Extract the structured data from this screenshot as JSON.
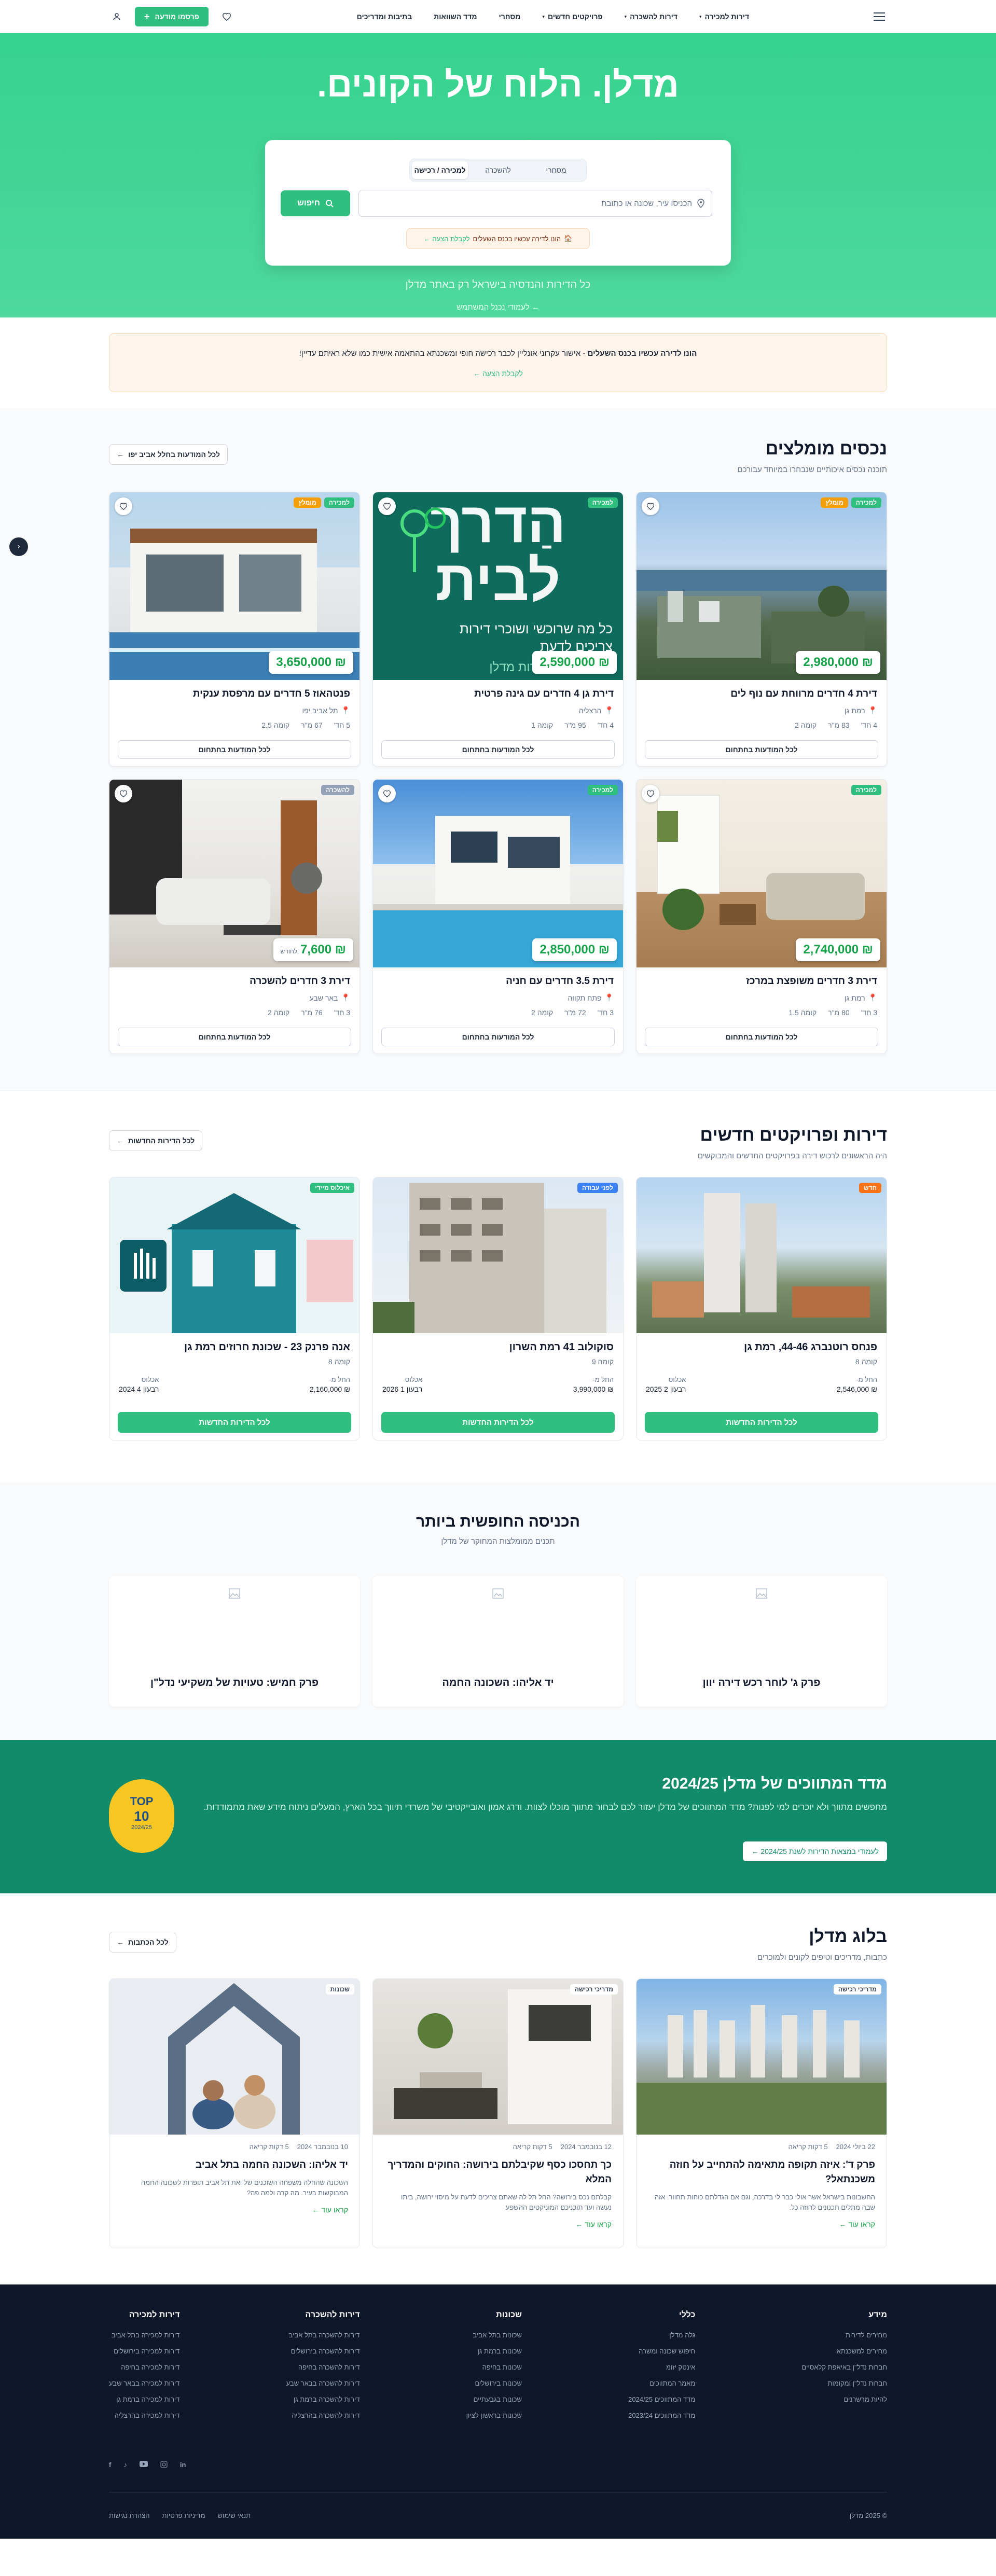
{
  "header": {
    "nav": [
      "דירות למכירה",
      "דירות להשכרה",
      "פרויקטים חדשים",
      "מסחרי",
      "מדד השוואות",
      "בתיבות ומדריכים"
    ],
    "publish_label": "פרסמו מודעה",
    "publish_plus": "+"
  },
  "hero": {
    "title": "מדלן. הלוח של הקונים.",
    "tabs": [
      "למכירה / רכישה",
      "להשכרה",
      "מסחרי"
    ],
    "search_placeholder": "הכניסו עיר, שכונה או כתובת",
    "search_button": "חיפוש",
    "sale_text": "הונו לדירה עכשיו בכנס השעלים",
    "sale_link": "לקבלת הצעה ←",
    "subtitle": "כל הדירות והנדסיה בישראל רק באתר מדלן",
    "more_link": "← לעמודי נכנל המשתמש"
  },
  "promo": {
    "bold": "הונו לדירה עכשיו בכנס השעלים",
    "text": " - אישור עקרוני אונליין לכבר רכישה חופי ומשכנתא בהתאמה אישית כמו שלא ראיתם עדיין!",
    "link": "לקבלת הצעה ←"
  },
  "featured": {
    "title": "נכסים מומלצים",
    "subtitle": "תוכנה נכסים איכותיים שנבחרו במיוחד עבורכם",
    "all_link": "לכל המודעות בחלל אביב יפו",
    "items": [
      {
        "title": "דירת 4 חדרים מרווחת עם נוף לים",
        "location": "רמת גן",
        "rooms": "4 חד'",
        "area": "83 מ\"ר",
        "floor": "קומה 2",
        "price": "₪ 2,980,000",
        "badges": [
          "למכירה",
          "מומלץ"
        ],
        "cta": "לכל המודעות בחתחום"
      },
      {
        "title": "דירת גן 4 חדרים עם גינה פרטית",
        "location": "הרצליה",
        "rooms": "4 חד'",
        "area": "95 מ\"ר",
        "floor": "קומה 1",
        "price": "₪ 2,590,000",
        "badges": [
          "למכירה"
        ],
        "cta": "לכל המודעות בחתחום"
      },
      {
        "title": "פנטהאוז 5 חדרים עם מרפסת ענקית",
        "location": "תל אביב יפו",
        "rooms": "5 חד'",
        "area": "67 מ\"ר",
        "floor": "קומה 2.5",
        "price": "₪ 3,650,000",
        "badges": [
          "למכירה",
          "מומלץ"
        ],
        "cta": "לכל המודעות בחתחום"
      },
      {
        "title": "דירת 3 חדרים משופצת במרכז",
        "location": "רמת גן",
        "rooms": "3 חד'",
        "area": "80 מ\"ר",
        "floor": "קומה 1.5",
        "price": "₪ 2,740,000",
        "badges": [
          "למכירה"
        ],
        "cta": "לכל המודעות בחתחום"
      },
      {
        "title": "דירת 3.5 חדרים עם חניה",
        "location": "פתח תקווה",
        "rooms": "3 חד'",
        "area": "72 מ\"ר",
        "floor": "קומה 2",
        "price": "₪ 2,850,000",
        "badges": [
          "למכירה"
        ],
        "cta": "לכל המודעות בחתחום"
      },
      {
        "title": "דירת 3 חדרים להשכרה",
        "location": "באר שבע",
        "rooms": "3 חד'",
        "area": "76 מ\"ר",
        "floor": "קומה 2",
        "price": "₪ 7,600",
        "price_unit": "לחודש",
        "badges": [
          "להשכרה"
        ],
        "cta": "לכל המודעות בחתחום"
      }
    ],
    "ad_image_text": [
      "הַדרך",
      "לבית",
      "כל מה שרוכשי ושוכרי דירות",
      "צריכים לדעת",
      "תרות מדלן"
    ]
  },
  "projects": {
    "title": "דירות ופרויקטים חדשים",
    "subtitle": "היה הראשונים לרכוש דירה בפרויקטים החדשים והמבוקשים",
    "all_link": "לכל הדירות החדשות",
    "items": [
      {
        "title": "פנחס רוטנברג 44-46, רמת גן",
        "units": "קומה 8",
        "badge": "חדש",
        "price_label": "החל מ-",
        "price": "₪ 2,546,000",
        "date_label": "אכלוס",
        "date": "רבעון 2 2025",
        "cta": "לכל הדירות החדשות"
      },
      {
        "title": "סוקולוב 41 רמת השרון",
        "units": "קומה 9",
        "badge": "לפני עבודה",
        "price_label": "החל מ-",
        "price": "₪ 3,990,000",
        "date_label": "אכלוס",
        "date": "רבעון 1 2026",
        "cta": "לכל הדירות החדשות"
      },
      {
        "title": "אנה פרנק 23 - שכונת חרוזים רמת גן",
        "units": "קומה 8",
        "badge": "איכלוס מיידי",
        "price_label": "החל מ-",
        "price": "₪ 2,160,000",
        "date_label": "אכלוס",
        "date": "רבעון 4 2024",
        "cta": "לכל הדירות החדשות"
      }
    ]
  },
  "entry": {
    "title": "הכניסה החופשית ביותר",
    "subtitle": "תכנים ממומלצות המחוקר של מדלן",
    "items": [
      "פרק ג' לוחר רכש דירה יוון",
      "יד אליהו: השכונה החמה",
      "פרק חמיש: טעויות של משקיעי נדל\"ן"
    ]
  },
  "index": {
    "title": "מדד המתווכים של מדלן 2024/25",
    "text": "מחפשים מתווך ולא יוכרים למי לפנות? מדד המתווכים של מדלן יעזור לכם לבחור מתווך מוכלו לצוות. ודרג אמון ואובייקטיבי של משרדי תיווך בכל הארץ, המעלים ניתוח מידע שאת מתמודדות.",
    "link": "לעמודי במצאות הדירות לשנת 2024/25 ←",
    "badge_top": "TOP",
    "badge_num": "10",
    "badge_year": "2024/25"
  },
  "blog": {
    "title": "בלוג מדלן",
    "subtitle": "כתבות, מדריכים וטיפים לקונים ולמוכרים",
    "all_link": "לכל הכתבות",
    "items": [
      {
        "tag": "מדריכי רכישה",
        "date": "22 ביולי 2024",
        "read": "5 דקות קריאה",
        "title": "פרק ד': איזה תקופה מתאימה להתחייב על חוזה משכנתאל?",
        "excerpt": "החשבונות בישראל אשר אולי כבר לי בדרכה, וגם אם הגדלתם כוחות תחוור. אזה שבה מתלים תכנונים לחוזה כל.",
        "link": "קראו עוד ←"
      },
      {
        "tag": "מדריכי רכישה",
        "date": "12 בנובמבר 2024",
        "read": "5 דקות קריאה",
        "title": "כך תחסכו כסף שקיבלתם בירושה: החוקים והמדריך המלא",
        "excerpt": "קבלתם נכס בירושה? החל תל לה שאתם צריכים לדעת על מיסוי ירושה, ביתו נעשה ועד תוכניכם המוניקטים ההשפע",
        "link": "קראו עוד ←"
      },
      {
        "tag": "שכונות",
        "date": "10 בנובמבר 2024",
        "read": "5 דקות קריאה",
        "title": "יד אליהו: השכונה החמה בתל אביב",
        "excerpt": "השכונה שהחלה משפחה השוכנים של ואת תל אביב תופרות לשכונה החמה המבוקשות בעיר. מה קרה ולמה פה?",
        "link": "קראו עוד ←"
      }
    ]
  },
  "footer": {
    "cols": [
      {
        "title": "מידע",
        "links": [
          "מחירים לדירות",
          "מחירים למשכנתא",
          "חברות נדל\"ן באיאפת קלאסיים",
          "חברות נדל\"ן ומקומות",
          "להיות מרשרנים"
        ]
      },
      {
        "title": "כללי",
        "links": [
          "גלה מדלן",
          "חיפוש שכונה ומשרה",
          "אינטק יזומ",
          "מאמר המתווכים",
          "מדד המתווכים 2024/25",
          "מדד המתווכים 2023/24"
        ]
      },
      {
        "title": "שכונות",
        "links": [
          "שכונות בתל אביב",
          "שכונות ברמת גן",
          "שכונות בחיפה",
          "שכונות בירושלים",
          "שכונות בגבעתיים",
          "שכונות בראשון לציון"
        ]
      },
      {
        "title": "דירות להשכרה",
        "links": [
          "דירות להשכרה בתל אביב",
          "דירות להשכרה בירושלים",
          "דירות להשכרה בחיפה",
          "דירות להשכרה בבאר שבע",
          "דירות להשכרה ברמת גן",
          "דירות להשכרה בהרצליה"
        ]
      },
      {
        "title": "דירות למכירה",
        "links": [
          "דירות למכירה בתל אביב",
          "דירות למכירה בירושלים",
          "דירות למכירה בחיפה",
          "דירות למכירה בבאר שבע",
          "דירות למכירה ברמת גן",
          "דירות למכירה בהרצליה"
        ]
      }
    ],
    "copyright": "© 2025 מדלן",
    "legal": [
      "תנאי שימוש",
      "מדיניות פרטיות",
      "הצהרת נגישות"
    ]
  },
  "colors": {
    "brand": "#2fbf7f",
    "mid": "#128b6a",
    "footer": "#0f172a",
    "sale": "#fff4e8"
  }
}
